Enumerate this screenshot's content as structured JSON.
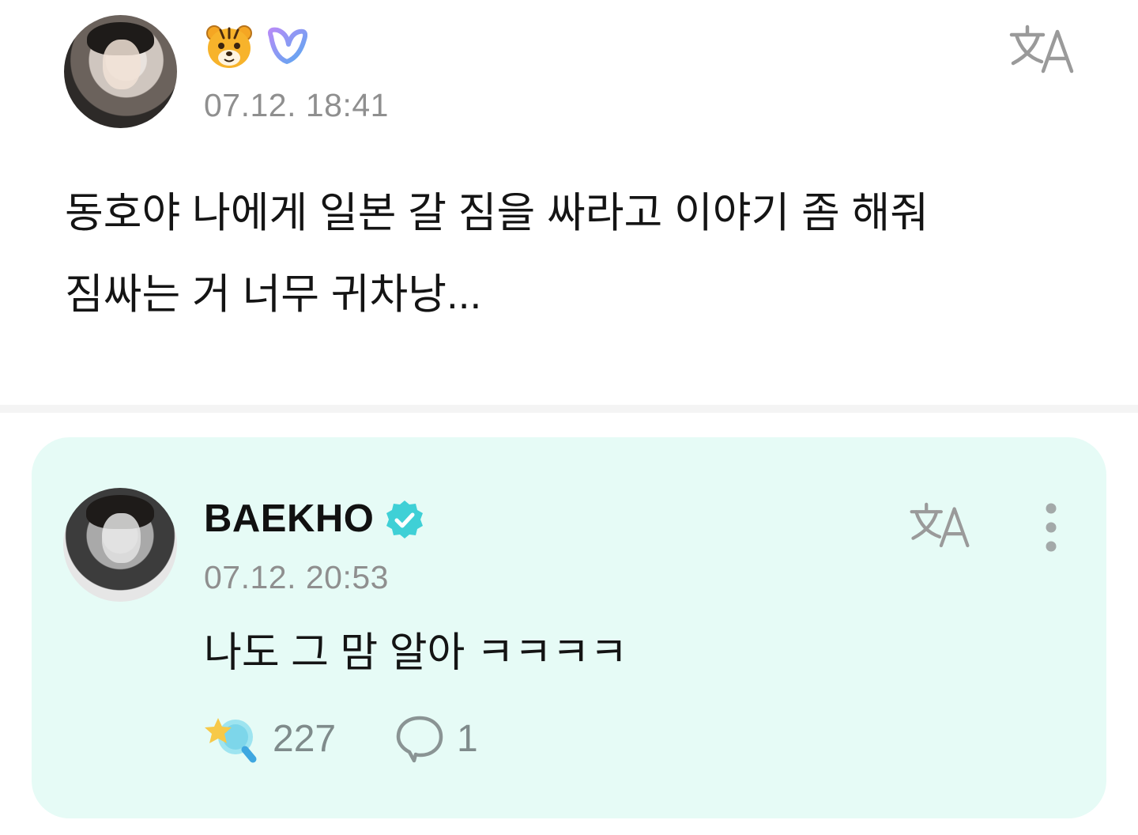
{
  "post": {
    "timestamp": "07.12. 18:41",
    "text": "동호야 나에게 일본 갈 짐을 싸라고 이야기 좀 해줘\n짐싸는 거 너무 귀차낭..."
  },
  "reply": {
    "author": "BAEKHO",
    "timestamp": "07.12. 20:53",
    "text": "나도 그 맘 알아 ㅋㅋㅋㅋ",
    "like_count": "227",
    "comment_count": "1"
  },
  "icons": {
    "tiger_badge": "tiger-emoji-icon",
    "membership_badge": "weverse-membership-icon",
    "translate": "translate-icon",
    "verified": "verified-badge-icon",
    "more": "more-vertical-icon",
    "like": "star-lightstick-icon",
    "comment": "speech-bubble-icon"
  },
  "colors": {
    "reply_background": "#e6fbf6",
    "verified": "#3fd0d6",
    "timestamp": "#8f8f8f",
    "counts": "#7f8b8b"
  }
}
